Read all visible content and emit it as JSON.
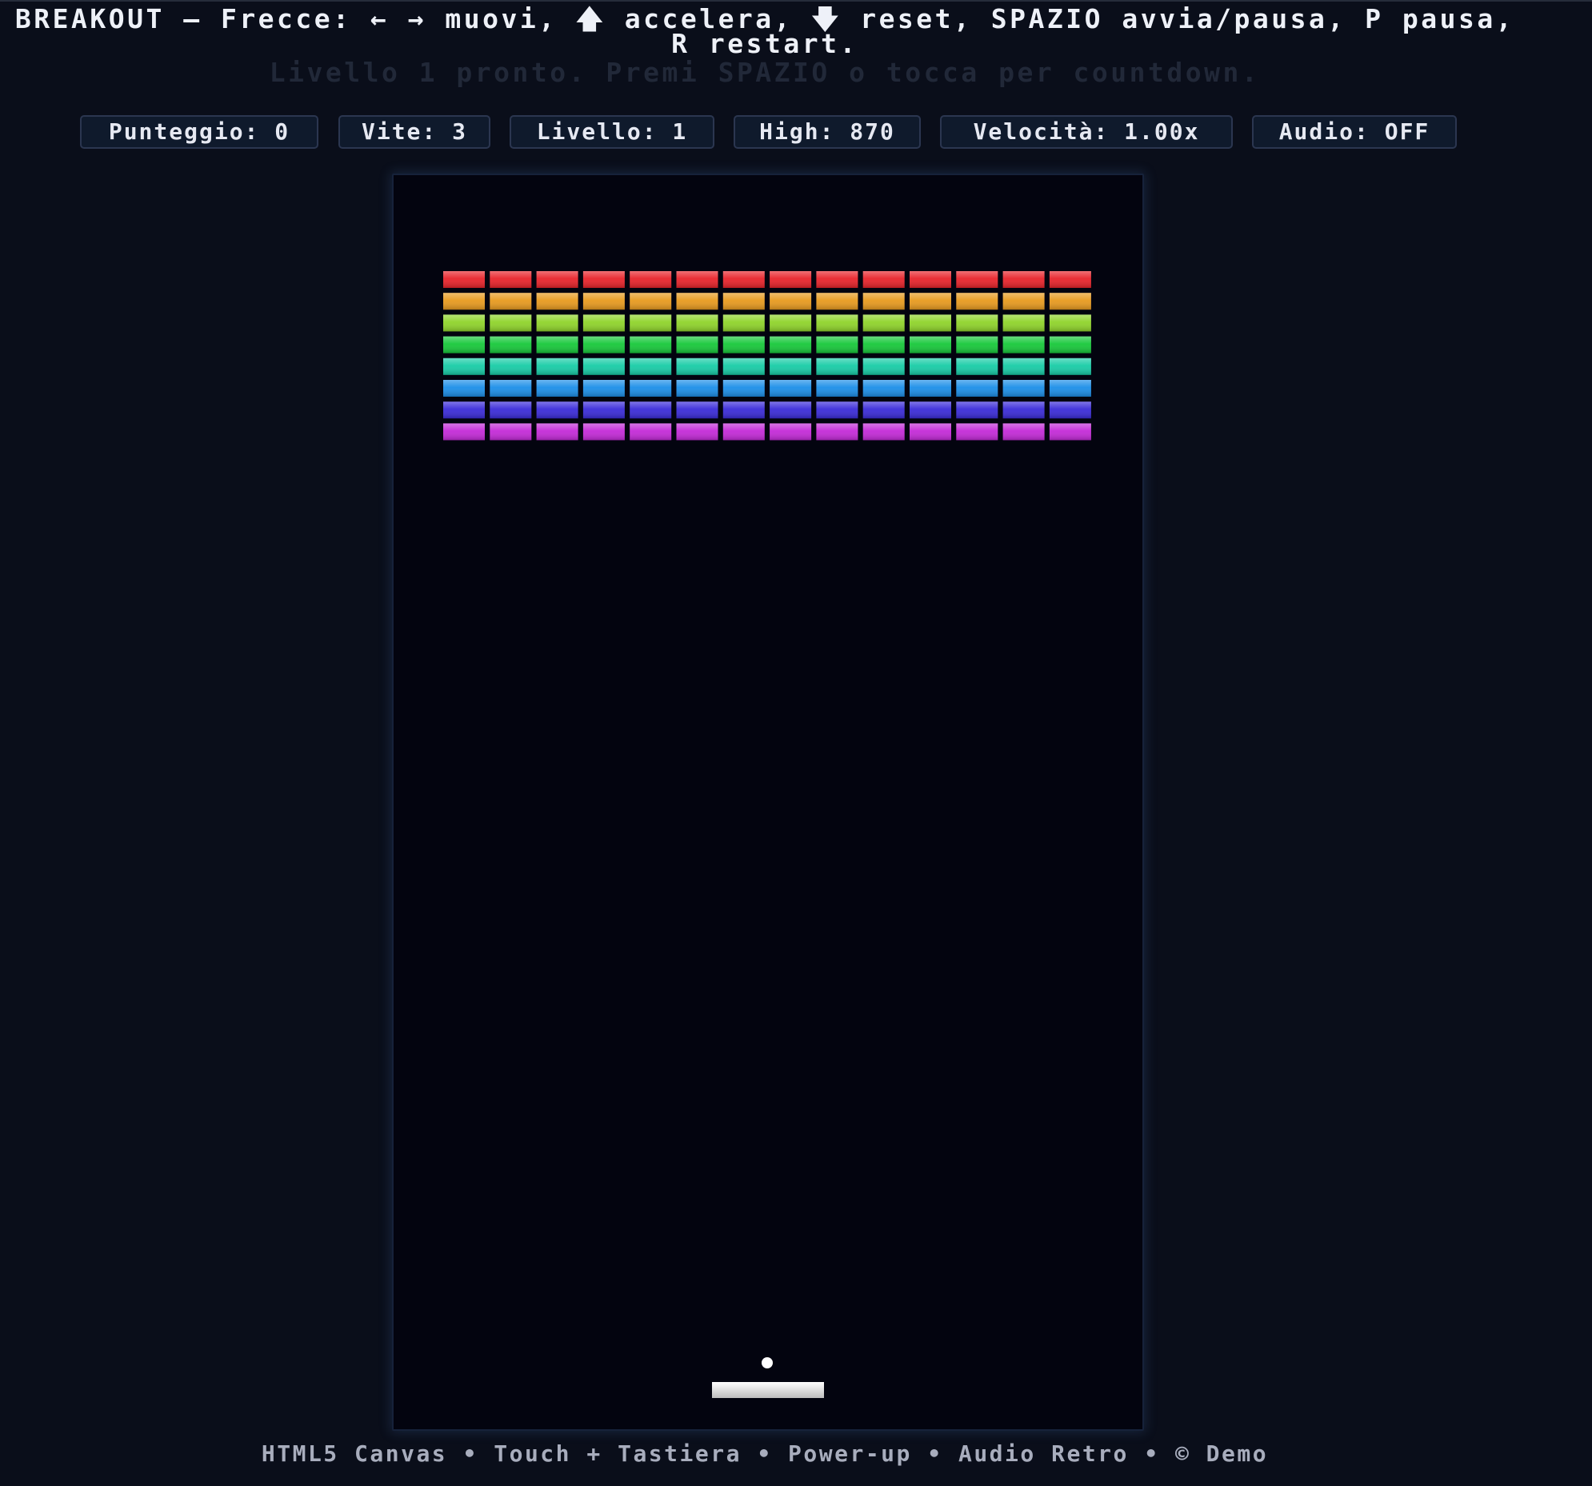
{
  "header": {
    "title": "BREAKOUT — Frecce: ← → muovi, 🡅 accelera, 🡇 reset, SPAZIO avvia/pausa, P pausa, R restart.",
    "status": "Livello 1 pronto. Premi SPAZIO o tocca per countdown."
  },
  "hud": {
    "score": "Punteggio: 0",
    "lives": "Vite: 3",
    "level": "Livello: 1",
    "high": "High: 870",
    "speed": "Velocità: 1.00x",
    "audio": "Audio: OFF"
  },
  "game": {
    "brick_columns": 14,
    "brick_rows": [
      {
        "color": "#e8232a"
      },
      {
        "color": "#e89a1e"
      },
      {
        "color": "#8fd42a"
      },
      {
        "color": "#17c83a"
      },
      {
        "color": "#17cca6"
      },
      {
        "color": "#1b8ee8"
      },
      {
        "color": "#3a2bd8"
      },
      {
        "color": "#c42ad8"
      }
    ],
    "paddle_color": "#e2e2e2",
    "ball_color": "#ffffff",
    "background_color": "#03040f"
  },
  "footer": {
    "text": "HTML5 Canvas • Touch + Tastiera • Power-up • Audio Retro • © Demo"
  }
}
